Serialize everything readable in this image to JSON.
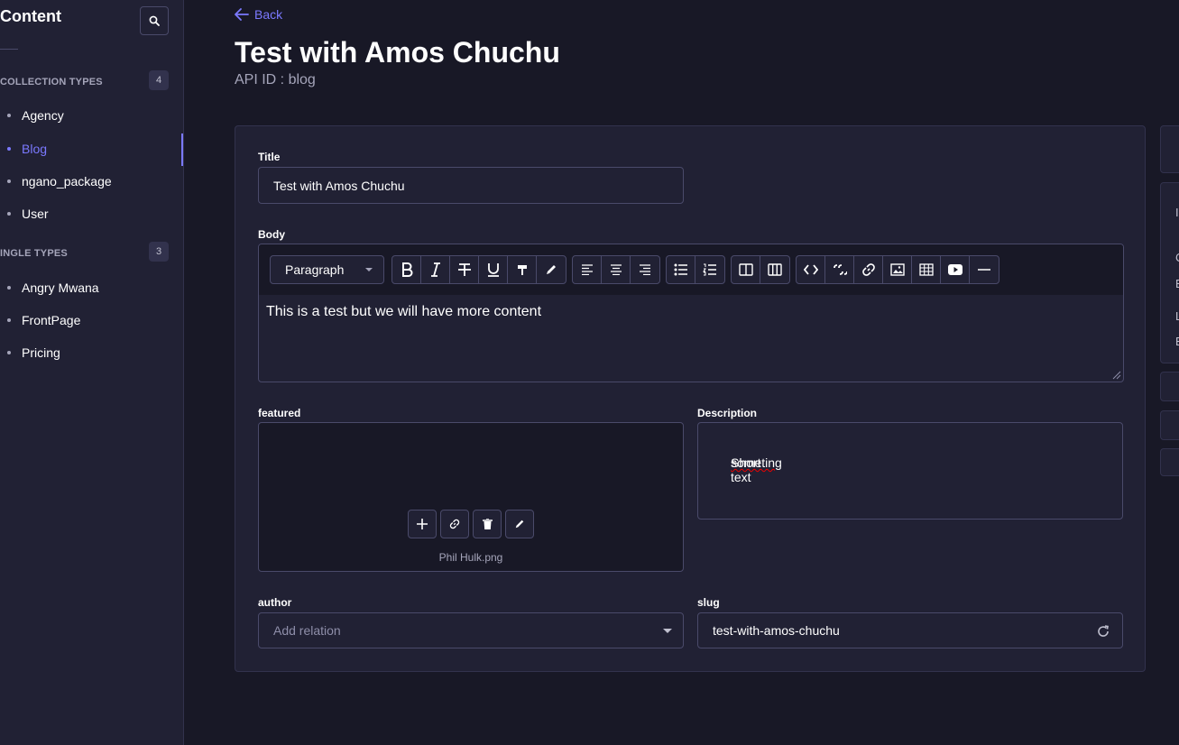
{
  "sidebar": {
    "title": "Content",
    "collection_types": {
      "label": "COLLECTION TYPES",
      "count": "4",
      "items": [
        {
          "label": "Agency"
        },
        {
          "label": "Blog",
          "active": true
        },
        {
          "label": "ngano_package"
        },
        {
          "label": "User"
        }
      ]
    },
    "single_types": {
      "label": "INGLE TYPES",
      "count": "3",
      "items": [
        {
          "label": "Angry Mwana"
        },
        {
          "label": "FrontPage"
        },
        {
          "label": "Pricing"
        }
      ]
    }
  },
  "header": {
    "back_label": "Back",
    "title": "Test with Amos Chuchu",
    "api_id": "API ID : blog"
  },
  "form": {
    "title": {
      "label": "Title",
      "value": "Test with Amos Chuchu"
    },
    "body": {
      "label": "Body",
      "format": "Paragraph",
      "content": "This is a test but we will have more content"
    },
    "featured": {
      "label": "featured",
      "file_name": "Phil Hulk.png"
    },
    "description": {
      "label": "Description",
      "value_plain": "Short text ",
      "value_misspelled": "someting"
    },
    "author": {
      "label": "author",
      "placeholder": "Add relation"
    },
    "slug": {
      "label": "slug",
      "value": "test-with-amos-chuchu"
    }
  },
  "right_panel": {
    "letters": [
      "I",
      "C",
      "E",
      "L",
      "E"
    ]
  },
  "colors": {
    "accent": "#7b79ff",
    "background": "#181826",
    "surface": "#212134",
    "border": "#4a4a6a"
  }
}
